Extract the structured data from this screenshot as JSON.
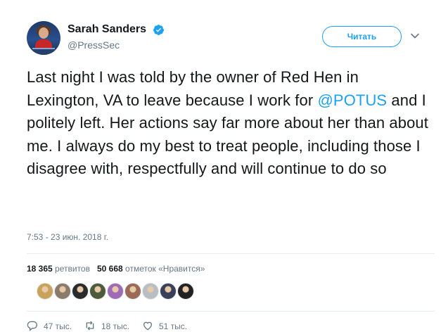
{
  "user": {
    "display_name": "Sarah Sanders",
    "handle": "@PressSec",
    "verified": true,
    "avatar_icon": "user-avatar"
  },
  "follow_button": {
    "label": "Читать"
  },
  "tweet": {
    "text_before": "Last night I was told by the owner of Red Hen in Lexington, VA to leave because I work for ",
    "mention": "@POTUS",
    "text_after": " and I politely left. Her actions say far more about her than about me. I always do my best to treat people, including those I disagree with, respectfully and will continue to do so",
    "timestamp": "7:53 - 23 июн. 2018 г."
  },
  "stats": {
    "retweets_count": "18 365",
    "retweets_label": "ретвитов",
    "likes_count": "50 668",
    "likes_label": "отметок «Нравится»"
  },
  "likers": [
    {
      "icon": "liker-avatar",
      "color": "#c9a35a"
    },
    {
      "icon": "liker-avatar",
      "color": "#8c7b6a"
    },
    {
      "icon": "liker-avatar",
      "color": "#2b2b2b"
    },
    {
      "icon": "liker-avatar",
      "color": "#4d5a3c"
    },
    {
      "icon": "liker-avatar",
      "color": "#a06bb5"
    },
    {
      "icon": "liker-avatar",
      "color": "#9a6a55"
    },
    {
      "icon": "liker-avatar",
      "color": "#b8bec4"
    },
    {
      "icon": "liker-avatar",
      "color": "#3a3f5a"
    },
    {
      "icon": "liker-avatar",
      "color": "#222222"
    }
  ],
  "actions": {
    "replies": "47 тыс.",
    "retweets": "18 тыс.",
    "likes": "51 тыс."
  },
  "colors": {
    "accent": "#1da1f2",
    "text": "#14171a",
    "secondary": "#657786",
    "divider": "#e6ecf0"
  }
}
